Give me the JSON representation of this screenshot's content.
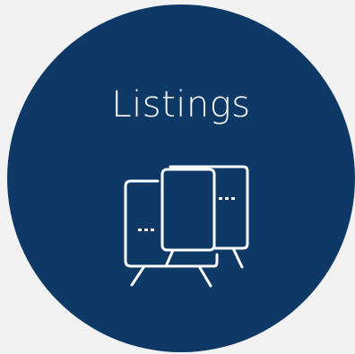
{
  "tile": {
    "label": "Listings",
    "icon": "listing-signs-icon",
    "background_color": "#0e3967",
    "foreground_color": "#ffffff",
    "page_background": "#f2f2f2"
  }
}
